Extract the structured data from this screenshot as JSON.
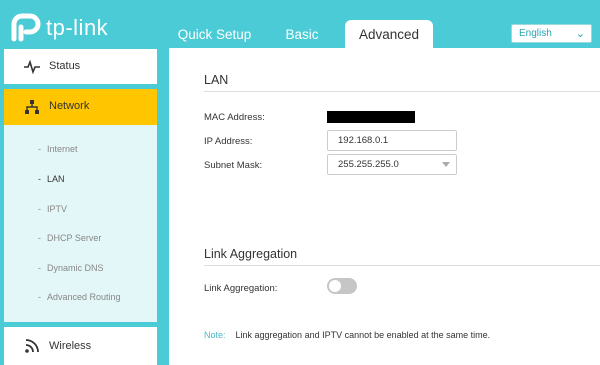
{
  "brand": {
    "logo_text": "tp-link"
  },
  "tabs": [
    {
      "label": "Quick Setup"
    },
    {
      "label": "Basic"
    },
    {
      "label": "Advanced",
      "active": true
    }
  ],
  "language": {
    "selected": "English"
  },
  "sidebar": {
    "status_label": "Status",
    "network_label": "Network",
    "network_items": [
      {
        "label": "Internet"
      },
      {
        "label": "LAN",
        "active": true
      },
      {
        "label": "IPTV"
      },
      {
        "label": "DHCP Server"
      },
      {
        "label": "Dynamic DNS"
      },
      {
        "label": "Advanced Routing"
      }
    ],
    "wireless_label": "Wireless",
    "dash": "-"
  },
  "lan": {
    "title": "LAN",
    "mac_label": "MAC Address:",
    "ip_label": "IP Address:",
    "ip_value": "192.168.0.1",
    "subnet_label": "Subnet Mask:",
    "subnet_value": "255.255.255.0"
  },
  "link_aggregation": {
    "title": "Link Aggregation",
    "label": "Link Aggregation:",
    "enabled": false
  },
  "note": {
    "label": "Note:",
    "text": "Link aggregation and IPTV cannot be enabled at the same time."
  },
  "colors": {
    "header_bg": "#4acbd6",
    "active_nav": "#ffc600",
    "accent": "#4abbc8"
  }
}
